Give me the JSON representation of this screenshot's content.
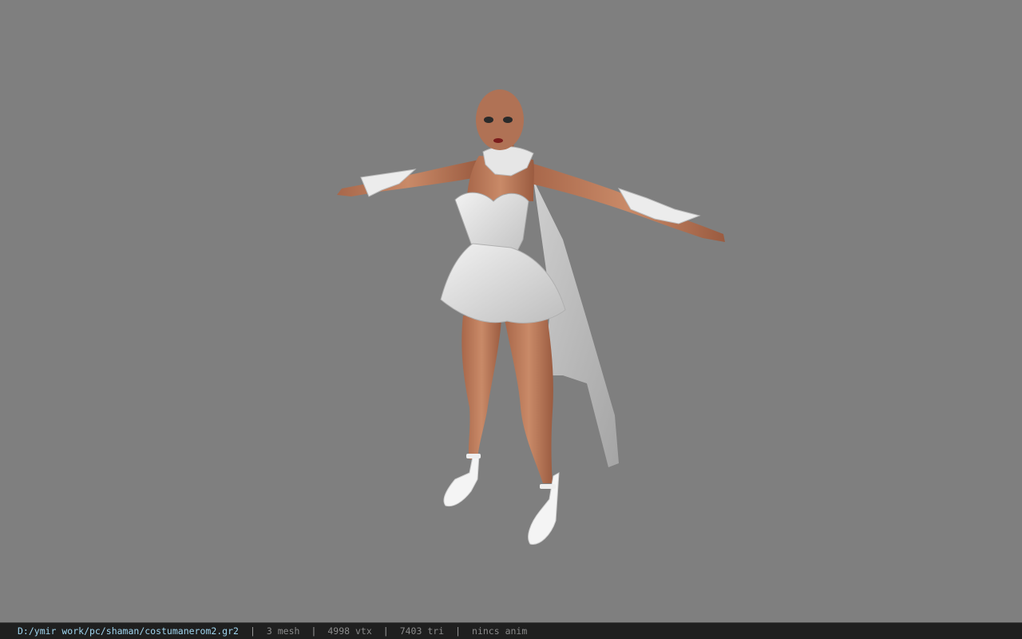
{
  "viewport": {
    "background_color": "#7f7f7f",
    "model": "female-character-white-dress-t-pose"
  },
  "status_bar": {
    "file_path": "D:/ymir work/pc/shaman/costumanerom2.gr2",
    "separator": "|",
    "mesh_count": "3 mesh",
    "vertex_count": "4998 vtx",
    "triangle_count": "7403 tri",
    "animation": "nincs anim",
    "path_color": "#9fd4ee"
  }
}
